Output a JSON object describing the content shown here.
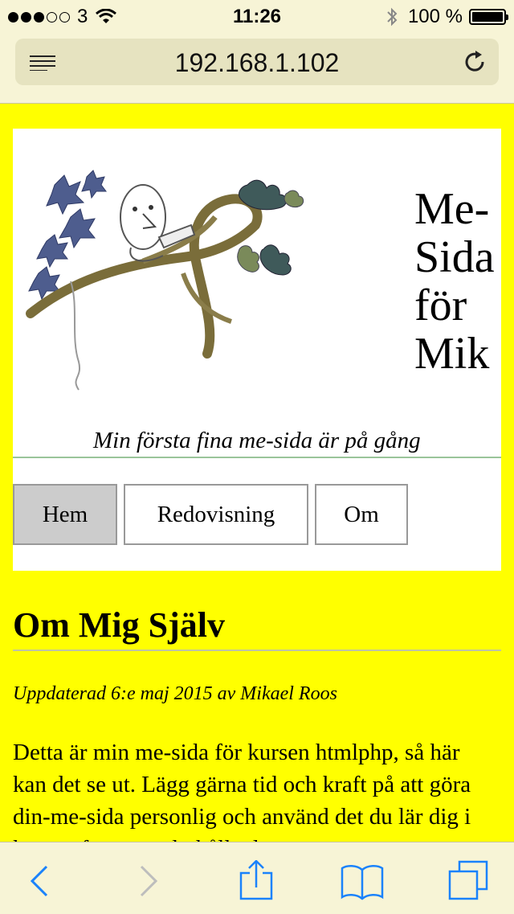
{
  "status_bar": {
    "carrier": "3",
    "time": "11:26",
    "battery": "100 %",
    "signal_dots_filled": 3,
    "signal_dots_total": 5
  },
  "browser": {
    "url": "192.168.1.102",
    "icons": [
      "reader-menu-icon",
      "reload-icon",
      "back-icon",
      "forward-icon",
      "share-icon",
      "bookmarks-icon",
      "tabs-icon"
    ]
  },
  "site": {
    "title": "Me-\nSida\nför\nMik",
    "slogan": "Min första fina me-sida är på gång",
    "nav": [
      {
        "label": "Hem",
        "active": true
      },
      {
        "label": "Redovisning",
        "active": false
      },
      {
        "label": "Om",
        "active": false
      }
    ]
  },
  "article": {
    "title": "Om Mig Själv",
    "byline": "Uppdaterad 6:e maj 2015 av Mikael Roos",
    "body": "Detta är min me-sida för kursen htmlphp, så här kan det se ut. Lägg gärna tid och kraft på att göra din-me-sida personlig och använd det du lär dig i kursen för att underhålla den."
  },
  "colors": {
    "page_background": "#ffff00",
    "browser_chrome": "#f7f4d6",
    "ios_blue": "#1a82fb",
    "nav_active": "#cccccc"
  }
}
